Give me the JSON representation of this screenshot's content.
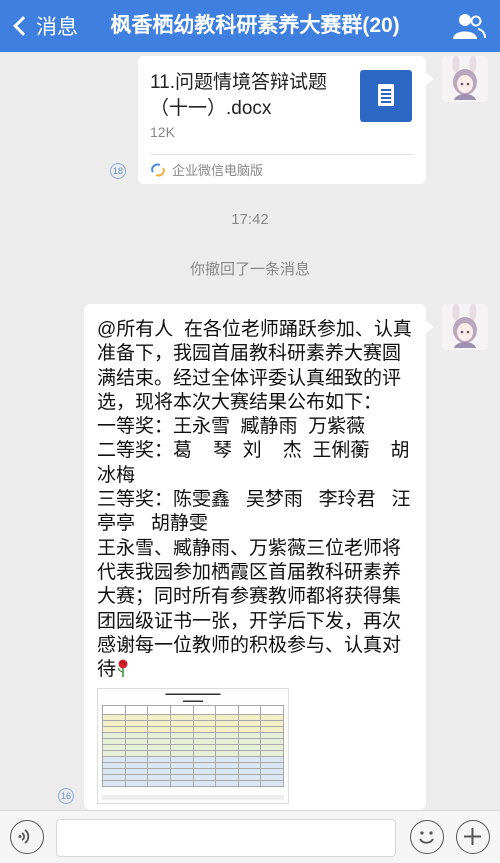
{
  "nav": {
    "back_label": "消息",
    "title": "枫香栖幼教科研素养大赛群(20)",
    "back_icon": "chevron-left-icon",
    "members_icon": "group-people-icon"
  },
  "file_message": {
    "file_name": "11.问题情境答辩试题（十一）.docx",
    "file_size": "12K",
    "source": "企业微信电脑版",
    "read_count": "18"
  },
  "timestamp": "17:42",
  "recall_notice": "你撤回了一条消息",
  "text_message": {
    "body": "@所有人  在各位老师踊跃参加、认真准备下，我园首届教科研素养大赛圆满结束。经过全体评委认真细致的评选，现将本次大赛结果公布如下：\n一等奖：王永雪  臧静雨  万紫薇\n二等奖：葛    琴  刘    杰  王俐蘅    胡冰梅\n三等奖：陈雯鑫   吴梦雨   李玲君   汪亭亭   胡静雯\n王永雪、臧静雨、万紫薇三位老师将代表我园参加栖霞区首届教科研素养大赛；同时所有参赛教师都将获得集团园级证书一张，开学后下发，再次感谢每一位教师的积极参与、认真对待",
    "emoji": "rose-icon",
    "read_count": "16"
  },
  "input_bar": {
    "placeholder": "",
    "voice_icon": "voice-icon",
    "emoji_icon": "emoji-icon",
    "plus_icon": "plus-icon"
  },
  "colors": {
    "nav_bg": "#3f7fe0",
    "chat_bg": "#ececec",
    "file_icon_bg": "#2d67c4"
  }
}
